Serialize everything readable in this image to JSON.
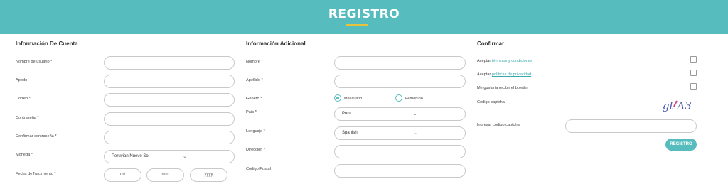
{
  "header": {
    "title": "REGISTRO"
  },
  "account": {
    "title": "Información De Cuenta",
    "username_label": "Nombre de usuario *",
    "nickname_label": "Apodo",
    "email_label": "Correo *",
    "password_label": "Contraseña *",
    "confirm_password_label": "Confirmar contraseña *",
    "currency_label": "Moneda *",
    "currency_value": "Peruvian Nuevo Sol",
    "birthdate_label": "Fecha de Nacimiento *",
    "day_placeholder": "dd",
    "month_placeholder": "mm",
    "year_placeholder": "yyyy"
  },
  "additional": {
    "title": "Información Adicional",
    "first_name_label": "Nombre *",
    "last_name_label": "Apellido *",
    "gender_label": "Genero *",
    "gender_male": "Masculino",
    "gender_female": "Femenino",
    "gender_selected": "Masculino",
    "country_label": "País *",
    "country_value": "Peru",
    "language_label": "Lenguaje *",
    "language_value": "Spanish",
    "address_label": "Dirección *",
    "postal_label": "Código Postal"
  },
  "confirm": {
    "title": "Confirmar",
    "terms_prefix": "Aceptar",
    "terms_link": "términos y condiciones",
    "privacy_prefix": "Aceptar",
    "privacy_link": "políticas de privacidad",
    "newsletter_label": "Me gustaría recibir el boletín",
    "captcha_label": "Código captcha",
    "captcha_text": "gt A3",
    "captcha_input_label": "Ingresar código captcha",
    "submit_label": "REGISTRO"
  },
  "colors": {
    "header": "#56bcbd",
    "accent_underline": "#e8c23a",
    "link": "#3aa9ab"
  }
}
